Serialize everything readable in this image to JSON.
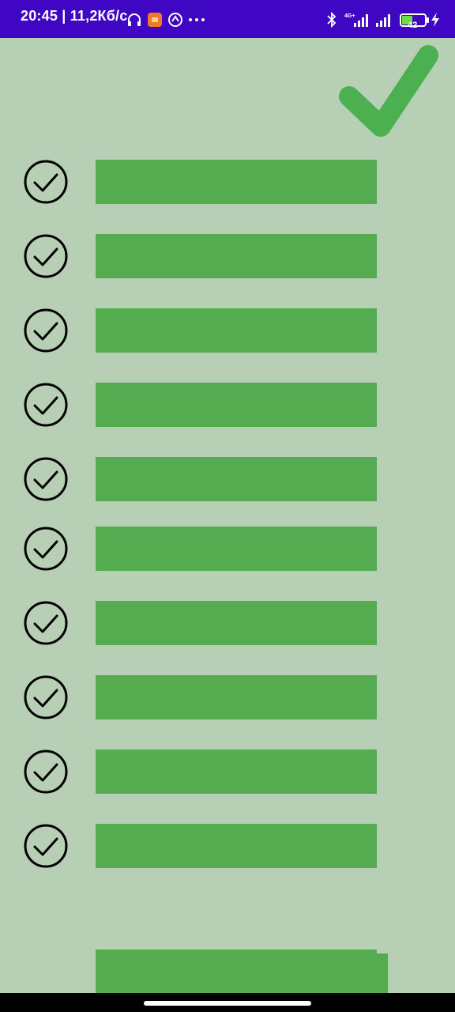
{
  "status_bar": {
    "time": "20:45",
    "speed": "11,2Кб/с",
    "battery_level": "42",
    "icons": [
      "headphones-icon",
      "app-notification-icon",
      "sync-icon",
      "more-dots-icon",
      "bluetooth-icon",
      "4g-signal-icon",
      "signal-icon",
      "battery-icon",
      "charging-icon"
    ]
  },
  "header": {
    "icon": "large-checkmark-icon",
    "color": "#4caf50"
  },
  "task_list": {
    "bar_color": "#55ab50",
    "items": [
      {
        "checked": true
      },
      {
        "checked": true
      },
      {
        "checked": true
      },
      {
        "checked": true
      },
      {
        "checked": true
      },
      {
        "checked": true
      },
      {
        "checked": true
      },
      {
        "checked": true
      },
      {
        "checked": true
      },
      {
        "checked": true
      }
    ]
  },
  "colors": {
    "background": "#b7cfb5",
    "status_bar": "#3f07c4"
  }
}
